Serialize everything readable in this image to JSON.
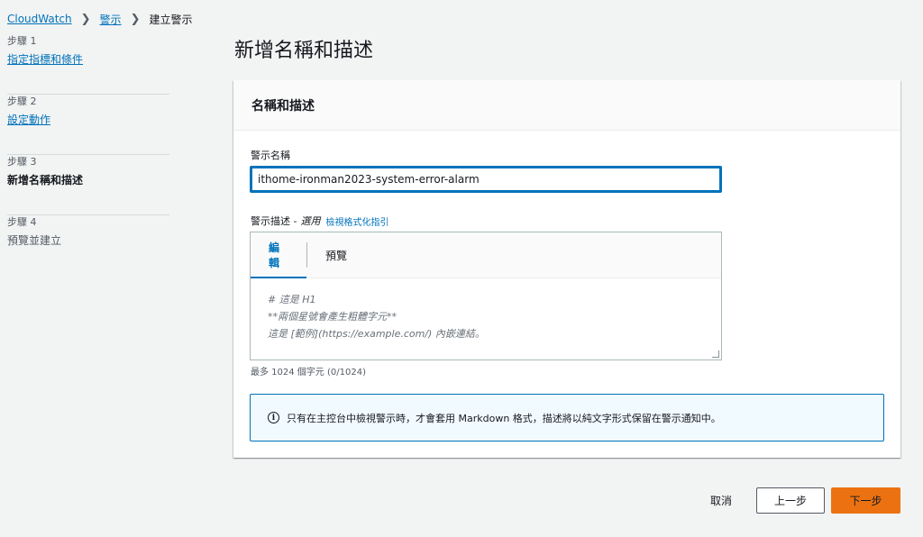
{
  "breadcrumb": {
    "items": [
      "CloudWatch",
      "警示",
      "建立警示"
    ],
    "separator_icon": "chevron-right-icon"
  },
  "steps": [
    {
      "num": "步驟 1",
      "label": "指定指標和條件",
      "state": "link"
    },
    {
      "num": "步驟 2",
      "label": "設定動作",
      "state": "link"
    },
    {
      "num": "步驟 3",
      "label": "新增名稱和描述",
      "state": "active"
    },
    {
      "num": "步驟 4",
      "label": "預覽並建立",
      "state": "disabled"
    }
  ],
  "page_title": "新增名稱和描述",
  "panel": {
    "header": "名稱和描述",
    "name_label": "警示名稱",
    "name_value": "ithome-ironman2023-system-error-alarm",
    "desc_label": "警示描述 -",
    "desc_optional": "選用",
    "desc_guide_link": "檢視格式化指引",
    "tabs": [
      "編輯",
      "預覽"
    ],
    "placeholder_lines": [
      "# 這是 H1",
      "**兩個星號會產生粗體字元**",
      "這是 [範例](https://example.com/) 內嵌連結。"
    ],
    "char_count": "最多 1024 個字元 (0/1024)",
    "info_text": "只有在主控台中檢視警示時，才會套用 Markdown 格式，描述將以純文字形式保留在警示通知中。",
    "info_icon": "info-circle-icon"
  },
  "footer": {
    "cancel": "取消",
    "previous": "上一步",
    "next": "下一步"
  },
  "colors": {
    "link": "#0073bb",
    "primary_button": "#ec7211",
    "background": "#f2f3f3"
  }
}
